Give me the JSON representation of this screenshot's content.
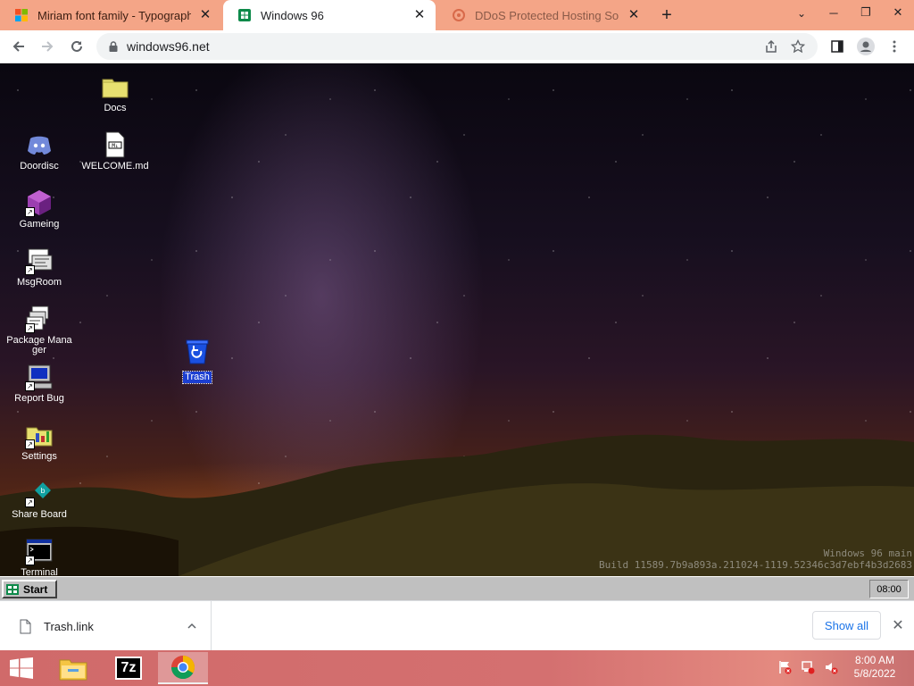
{
  "browser": {
    "tabs": [
      {
        "title": "Miriam font family - Typography",
        "icon": "windows-logo-icon",
        "state": "inactive"
      },
      {
        "title": "Windows 96",
        "icon": "windows96-icon",
        "state": "active"
      },
      {
        "title": "DDoS Protected Hosting Solutions",
        "icon": "ddos-hosting-icon",
        "state": "dim"
      }
    ],
    "url": "windows96.net"
  },
  "desktop": {
    "icons": [
      {
        "label": "Docs",
        "icon": "folder-icon",
        "shortcut": false
      },
      {
        "label": "WELCOME.md",
        "icon": "markdown-file-icon",
        "shortcut": false
      },
      {
        "label": "Doordisc",
        "icon": "discord-icon",
        "shortcut": false
      },
      {
        "label": "Gameing",
        "icon": "cube-game-icon",
        "shortcut": true
      },
      {
        "label": "MsgRoom",
        "icon": "msgroom-icon",
        "shortcut": true
      },
      {
        "label": "Package Manager",
        "icon": "package-manager-icon",
        "shortcut": true
      },
      {
        "label": "Report Bug",
        "icon": "report-bug-computer-icon",
        "shortcut": true
      },
      {
        "label": "Settings",
        "icon": "settings-folder-icon",
        "shortcut": true
      },
      {
        "label": "Share Board",
        "icon": "share-board-icon",
        "shortcut": true
      },
      {
        "label": "Terminal",
        "icon": "terminal-icon",
        "shortcut": true
      },
      {
        "label": "Trash",
        "icon": "trash-icon",
        "shortcut": false,
        "selected": true
      }
    ],
    "build_line1": "Windows 96 main",
    "build_line2": "Build 11589.7b9a893a.211024-1119.52346c3d7ebf4b3d2683"
  },
  "w96_taskbar": {
    "start_label": "Start",
    "clock": "08:00"
  },
  "download_shelf": {
    "file_name": "Trash.link",
    "show_all_label": "Show all"
  },
  "windows_taskbar": {
    "apps": [
      {
        "icon": "file-explorer-icon",
        "active": false
      },
      {
        "icon": "7zip-icon",
        "label": "7z",
        "active": false
      },
      {
        "icon": "chrome-icon",
        "active": true
      }
    ],
    "time": "8:00 AM",
    "date": "5/8/2022"
  },
  "colors": {
    "tab_strip": "#f4a587",
    "win96_selection": "#1c3fd1",
    "taskbar": "#d06a6a"
  }
}
